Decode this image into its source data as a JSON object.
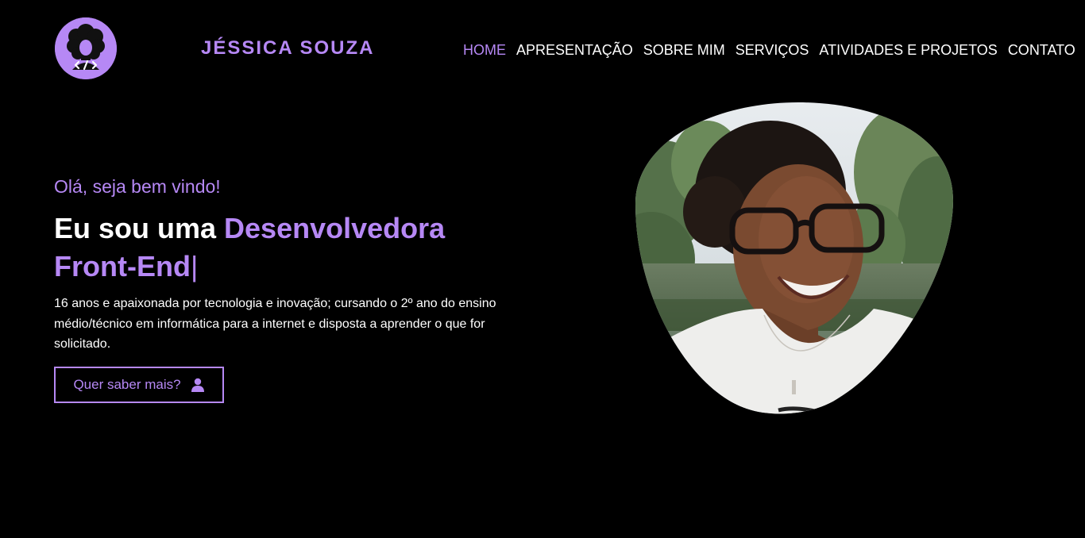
{
  "header": {
    "logo_icon": "afro-avatar-code-icon",
    "brand": "JÉSSICA SOUZA"
  },
  "nav": {
    "items": [
      {
        "label": "HOME",
        "active": true
      },
      {
        "label": "APRESENTAÇÃO",
        "active": false
      },
      {
        "label": "SOBRE MIM",
        "active": false
      },
      {
        "label": "SERVIÇOS",
        "active": false
      },
      {
        "label": "ATIVIDADES E PROJETOS",
        "active": false
      },
      {
        "label": "CONTATO",
        "active": false
      }
    ]
  },
  "hero": {
    "greeting": "Olá, seja bem vindo!",
    "headline_prefix": "Eu sou uma ",
    "headline_accent": "Desenvolvedora Front-End",
    "cursor": "|",
    "description": "16 anos e apaixonada por tecnologia e inovação; cursando o 2º ano do ensino médio/técnico em informática para a internet e disposta a aprender o que for solicitado.",
    "cta_label": "Quer saber mais?",
    "cta_icon": "user-icon"
  },
  "photo": {
    "subject": "profile-photo"
  },
  "colors": {
    "background": "#000000",
    "accent": "#b688f5",
    "text": "#ffffff"
  }
}
